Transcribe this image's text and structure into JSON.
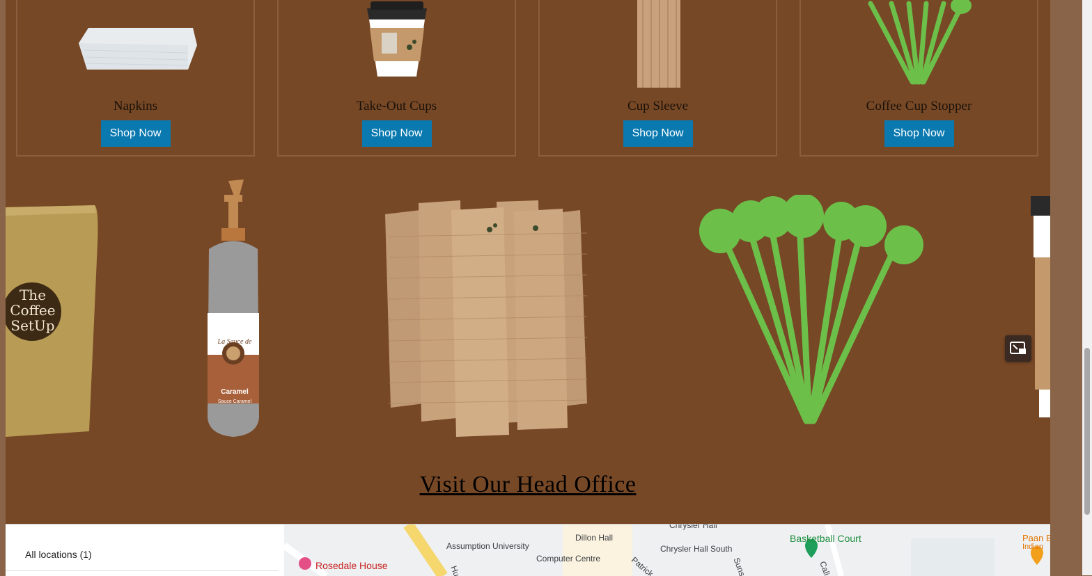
{
  "products": [
    {
      "title": "Napkins",
      "button": "Shop Now"
    },
    {
      "title": "Take-Out Cups",
      "button": "Shop Now"
    },
    {
      "title": "Cup Sleeve",
      "button": "Shop Now"
    },
    {
      "title": "Coffee Cup Stopper",
      "button": "Shop Now"
    }
  ],
  "carousel": {
    "bag_text": [
      "The",
      "Coffee",
      "SetUp"
    ],
    "bottle_brand": "La Sauce de",
    "bottle_flavor": "Caramel",
    "bottle_sub": "Sauce Caramel"
  },
  "head_office": {
    "title": "Visit Our Head Office"
  },
  "map": {
    "locations_label": "All locations (1)",
    "labels": [
      "Chrysler Hall",
      "Dillon Hall",
      "Assumption University",
      "Chrysler Hall South",
      "Basketball Court",
      "Computer Centre",
      "Rosedale House",
      "Paan B",
      "Indian",
      "Patrick",
      "Suns",
      "Cali",
      "Hu"
    ]
  },
  "colors": {
    "page_bg": "#774826",
    "button": "#0a79b0",
    "card_border": "#8d5d3f",
    "spoon_green": "#6cc04a"
  }
}
